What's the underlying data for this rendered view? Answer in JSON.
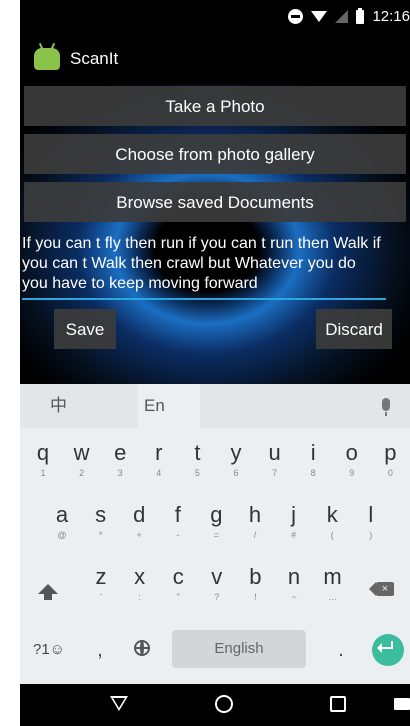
{
  "status_bar": {
    "time": "12:16"
  },
  "app": {
    "title": "ScanIt"
  },
  "buttons": {
    "take_photo": "Take a Photo",
    "choose_gallery": "Choose from photo gallery",
    "browse_docs": "Browse saved Documents",
    "save": "Save",
    "discard": "Discard"
  },
  "ocr_text": "If you can t fly then run if you can t run then Walk if you can t Walk then crawl but Whatever you do you have to keep moving forward",
  "keyboard": {
    "tabs": {
      "chinese": "中",
      "english": "En"
    },
    "row1": [
      {
        "k": "q",
        "s": "1"
      },
      {
        "k": "w",
        "s": "2"
      },
      {
        "k": "e",
        "s": "3"
      },
      {
        "k": "r",
        "s": "4"
      },
      {
        "k": "t",
        "s": "5"
      },
      {
        "k": "y",
        "s": "6"
      },
      {
        "k": "u",
        "s": "7"
      },
      {
        "k": "i",
        "s": "8"
      },
      {
        "k": "o",
        "s": "9"
      },
      {
        "k": "p",
        "s": "0"
      }
    ],
    "row2": [
      {
        "k": "a",
        "s": "@"
      },
      {
        "k": "s",
        "s": "*"
      },
      {
        "k": "d",
        "s": "+"
      },
      {
        "k": "f",
        "s": "-"
      },
      {
        "k": "g",
        "s": "="
      },
      {
        "k": "h",
        "s": "/"
      },
      {
        "k": "j",
        "s": "#"
      },
      {
        "k": "k",
        "s": "("
      },
      {
        "k": "l",
        "s": ")"
      }
    ],
    "row3": [
      {
        "k": "z",
        "s": "'"
      },
      {
        "k": "x",
        "s": ":"
      },
      {
        "k": "c",
        "s": "\""
      },
      {
        "k": "v",
        "s": "?"
      },
      {
        "k": "b",
        "s": "!"
      },
      {
        "k": "n",
        "s": "~"
      },
      {
        "k": "m",
        "s": "…"
      }
    ],
    "symbols_key": "?1☺",
    "comma": ",",
    "space_label": "English",
    "period": "."
  }
}
